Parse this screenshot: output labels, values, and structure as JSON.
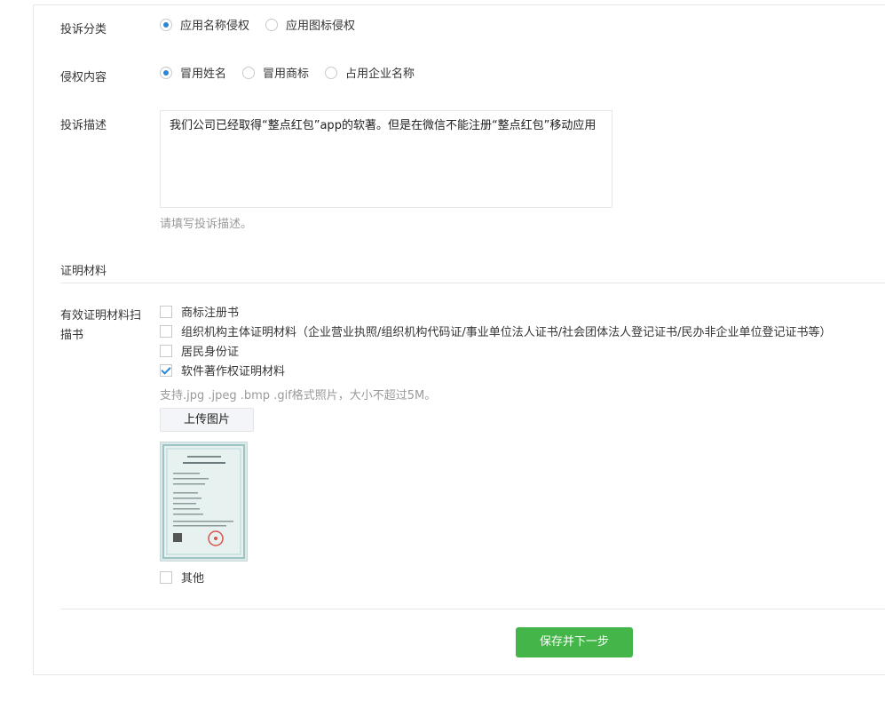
{
  "form": {
    "category": {
      "label": "投诉分类",
      "options": [
        "应用名称侵权",
        "应用图标侵权"
      ],
      "selected": 0
    },
    "infringement": {
      "label": "侵权内容",
      "options": [
        "冒用姓名",
        "冒用商标",
        "占用企业名称"
      ],
      "selected": 0
    },
    "description": {
      "label": "投诉描述",
      "value": "我们公司已经取得“整点红包”app的软著。但是在微信不能注册“整点红包”移动应用",
      "hint": "请填写投诉描述。"
    },
    "evidence_section": {
      "title": "证明材料"
    },
    "evidence": {
      "label_line1": "有效证明材料扫",
      "label_line2": "描书",
      "options": [
        {
          "label": "商标注册书",
          "checked": false
        },
        {
          "label": "组织机构主体证明材料（企业营业执照/组织机构代码证/事业单位法人证书/社会团体法人登记证书/民办非企业单位登记证书等）",
          "checked": false
        },
        {
          "label": "居民身份证",
          "checked": false
        },
        {
          "label": "软件著作权证明材料",
          "checked": true
        }
      ],
      "hint": "支持.jpg .jpeg .bmp .gif格式照片，大小不超过5M。",
      "upload_label": "上传图片",
      "other_label": "其他",
      "other_checked": false
    },
    "save_label": "保存并下一步"
  },
  "colors": {
    "accent": "#44b549",
    "radio_on": "#2f86d6",
    "border": "#e7e7eb"
  }
}
